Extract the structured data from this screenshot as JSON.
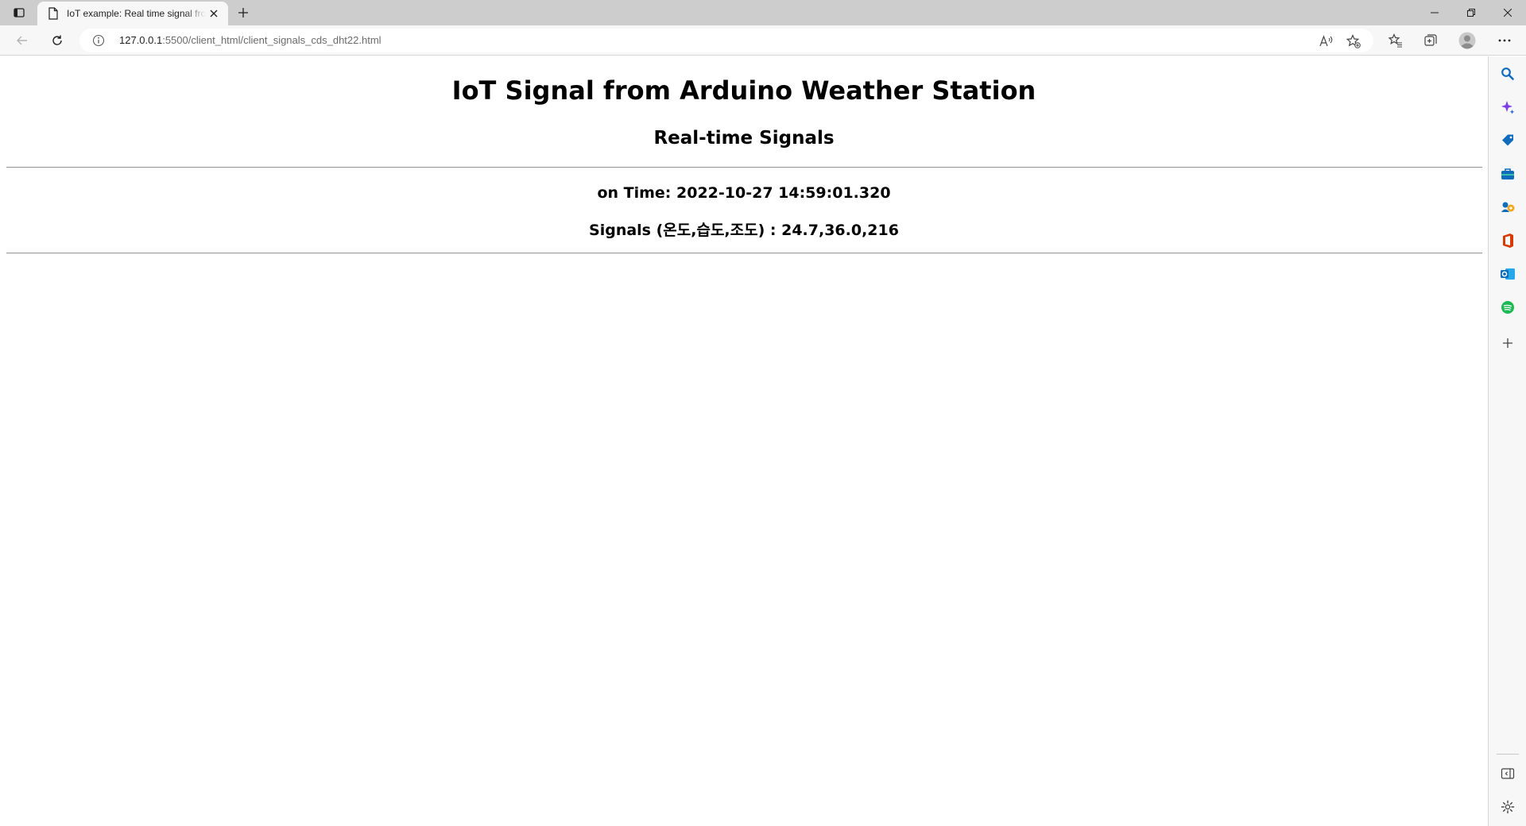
{
  "browser": {
    "tab": {
      "title": "IoT example: Real time signal from Arduino Weather Station"
    },
    "address": {
      "host": "127.0.0.1",
      "rest": ":5500/client_html/client_signals_cds_dht22.html"
    }
  },
  "page": {
    "title": "IoT Signal from Arduino Weather Station",
    "subtitle": "Real-time Signals",
    "time_line": "on Time: 2022-10-27 14:59:01.320",
    "signals_line": "Signals (온도,습도,조도) : 24.7,36.0,216"
  },
  "sidebar": {
    "icons": [
      "search-icon",
      "copilot-icon",
      "shopping-tag-icon",
      "tools-icon",
      "games-icon",
      "office-icon",
      "outlook-icon",
      "spotify-icon",
      "add-icon"
    ],
    "bottom_icons": [
      "hide-sidebar-icon",
      "settings-icon"
    ]
  },
  "colors": {
    "tabstrip": "#cdcdcd",
    "toolbar": "#f7f7f7",
    "accent_blue": "#0f6cbd",
    "office_red": "#d83b01",
    "spotify_green": "#1db954"
  }
}
